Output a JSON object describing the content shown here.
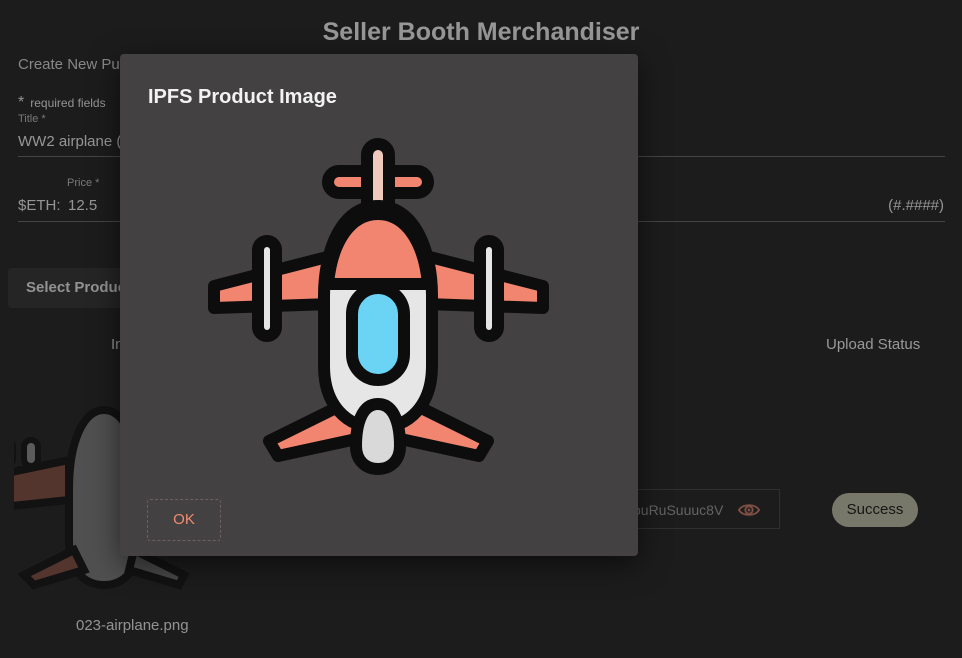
{
  "app": {
    "title": "Seller Booth Merchandiser",
    "subtitle": "Create New Pu",
    "required_note": "required fields",
    "required_star": "*"
  },
  "form": {
    "title_label": "Title *",
    "title_value": "WW2 airplane (",
    "price_label": "Price *",
    "price_prefix": "$ETH:",
    "price_value": "12.5",
    "price_hint": "(#.####)",
    "select_button": "Select Produc"
  },
  "table": {
    "col_image": "In",
    "col_upload": "Upload Status",
    "row": {
      "filename": "023-airplane.png",
      "cid_fragment": "ouRuSuuuc8V",
      "status": "Success"
    }
  },
  "modal": {
    "title": "IPFS Product Image",
    "ok_label": "OK"
  },
  "colors": {
    "accent": "#f28b6f",
    "plane_salmon": "#f2856f",
    "plane_window": "#6bd3f3",
    "plane_body": "#e6e6e6"
  },
  "icons": {
    "reveal": "eye-icon",
    "product": "airplane-icon"
  }
}
